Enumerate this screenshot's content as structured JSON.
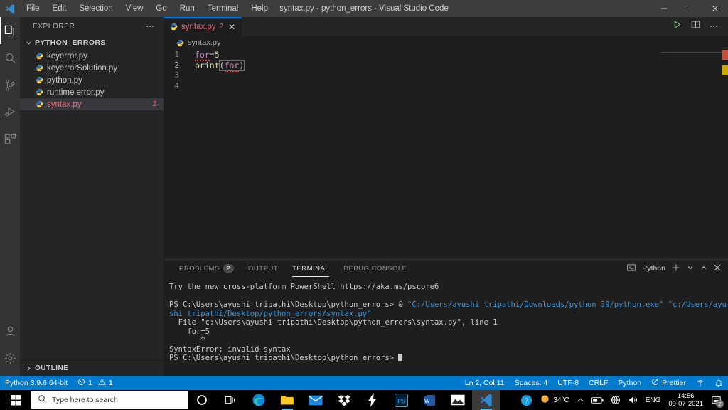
{
  "titlebar": {
    "logo_icon": "vscode-logo-icon",
    "menus": [
      "File",
      "Edit",
      "Selection",
      "View",
      "Go",
      "Run",
      "Terminal",
      "Help"
    ],
    "title": "syntax.py - python_errors - Visual Studio Code",
    "minimize_icon": "minimize-icon",
    "maximize_icon": "maximize-icon",
    "close_icon": "close-icon"
  },
  "activitybar": {
    "items": [
      {
        "name": "explorer",
        "icon": "files-icon",
        "active": true
      },
      {
        "name": "search",
        "icon": "search-icon",
        "active": false
      },
      {
        "name": "source-control",
        "icon": "source-control-icon",
        "active": false
      },
      {
        "name": "run-debug",
        "icon": "run-debug-icon",
        "active": false
      },
      {
        "name": "extensions",
        "icon": "extensions-icon",
        "active": false
      }
    ],
    "bottom": [
      {
        "name": "accounts",
        "icon": "account-icon"
      },
      {
        "name": "settings",
        "icon": "gear-icon"
      }
    ]
  },
  "sidebar": {
    "header": "EXPLORER",
    "more_actions_icon": "ellipsis-icon",
    "folder": "PYTHON_ERRORS",
    "folder_chevron_icon": "chevron-down-icon",
    "files": [
      {
        "name": "keyerror.py",
        "badge": "",
        "selected": false
      },
      {
        "name": "keyerrorSolution.py",
        "badge": "",
        "selected": false
      },
      {
        "name": "python.py",
        "badge": "",
        "selected": false
      },
      {
        "name": "runtime error.py",
        "badge": "",
        "selected": false
      },
      {
        "name": "syntax.py",
        "badge": "2",
        "selected": true
      }
    ],
    "outline": "OUTLINE",
    "outline_chevron_icon": "chevron-right-icon"
  },
  "editor": {
    "tab": {
      "label": "syntax.py",
      "badge": "2",
      "file_icon": "python-file-icon",
      "close_icon": "close-icon"
    },
    "actions": [
      {
        "name": "run-python-file",
        "icon": "play-icon"
      },
      {
        "name": "split-editor",
        "icon": "split-editor-icon"
      },
      {
        "name": "more-actions",
        "icon": "ellipsis-icon"
      }
    ],
    "breadcrumb": "syntax.py",
    "breadcrumb_icon": "python-file-icon",
    "lines": [
      {
        "number": "1",
        "tokens": [
          {
            "t": "for",
            "c": "kw"
          },
          {
            "t": "=",
            "c": "punct"
          },
          {
            "t": "5",
            "c": "num"
          }
        ]
      },
      {
        "number": "2",
        "tokens": [
          {
            "t": "print",
            "c": "fn"
          },
          {
            "t": "(",
            "c": "punct"
          },
          {
            "t": "for",
            "c": "kw"
          },
          {
            "t": ")",
            "c": "punct"
          }
        ]
      },
      {
        "number": "3",
        "tokens": []
      },
      {
        "number": "4",
        "tokens": []
      }
    ]
  },
  "panel": {
    "tabs": [
      {
        "label": "PROBLEMS",
        "badge": "2",
        "active": false
      },
      {
        "label": "OUTPUT",
        "badge": "",
        "active": false
      },
      {
        "label": "TERMINAL",
        "badge": "",
        "active": true
      },
      {
        "label": "DEBUG CONSOLE",
        "badge": "",
        "active": false
      }
    ],
    "shell_icon": "terminal-icon",
    "shell_name": "Python",
    "actions": [
      {
        "name": "new-terminal",
        "icon": "plus-icon"
      },
      {
        "name": "terminal-dropdown",
        "icon": "chevron-down-icon"
      },
      {
        "name": "maximize-panel",
        "icon": "chevron-up-icon"
      },
      {
        "name": "close-panel",
        "icon": "close-icon"
      }
    ],
    "terminal_lines": [
      {
        "text": "Try the new cross-platform PowerShell https://aka.ms/pscore6",
        "class": ""
      },
      {
        "text": "",
        "class": ""
      },
      {
        "text": "PS C:\\Users\\ayushi tripathi\\Desktop\\python_errors> & ",
        "class": "",
        "suffix": "\"C:/Users/ayushi tripathi/Downloads/python 39/python.exe\" \"c:/Users/ayushi tripathi/Desktop/python_errors/syntax.py\"",
        "suffix_class": "t-path"
      },
      {
        "text": "  File \"c:\\Users\\ayushi tripathi\\Desktop\\python_errors\\syntax.py\", line 1",
        "class": ""
      },
      {
        "text": "    for=5",
        "class": ""
      },
      {
        "text": "       ^",
        "class": ""
      },
      {
        "text": "SyntaxError: invalid syntax",
        "class": ""
      },
      {
        "text": "PS C:\\Users\\ayushi tripathi\\Desktop\\python_errors> ",
        "class": "",
        "cursor": true
      }
    ]
  },
  "statusbar": {
    "left": [
      {
        "name": "python-interpreter",
        "label": "Python 3.9.6 64-bit",
        "icon": ""
      },
      {
        "name": "problems-count",
        "label": "1",
        "icon": "error-icon",
        "label2": "1",
        "icon2": "warning-icon"
      }
    ],
    "right": [
      {
        "name": "editor-position",
        "label": "Ln 2, Col 11"
      },
      {
        "name": "indentation",
        "label": "Spaces: 4"
      },
      {
        "name": "encoding",
        "label": "UTF-8"
      },
      {
        "name": "eol",
        "label": "CRLF"
      },
      {
        "name": "language-mode",
        "label": "Python"
      },
      {
        "name": "prettier",
        "label": "Prettier",
        "icon": "prohibited-icon"
      },
      {
        "name": "remote-indicator",
        "label": "",
        "icon": "broadcast-icon"
      },
      {
        "name": "notifications",
        "label": "",
        "icon": "bell-icon"
      }
    ],
    "background": "#007acc"
  },
  "taskbar": {
    "start_icon": "windows-start-icon",
    "search_icon": "search-icon",
    "search_placeholder": "Type here to search",
    "cortana_icon": "cortana-icon",
    "apps": [
      {
        "name": "task-view",
        "icon": "task-view-icon",
        "active": false,
        "running": false
      },
      {
        "name": "microsoft-edge",
        "icon": "edge-icon",
        "active": false,
        "running": false
      },
      {
        "name": "file-explorer",
        "icon": "folder-icon",
        "active": false,
        "running": true
      },
      {
        "name": "mail",
        "icon": "mail-icon",
        "active": false,
        "running": false
      },
      {
        "name": "dropbox",
        "icon": "dropbox-icon",
        "active": false,
        "running": false
      },
      {
        "name": "lightning-app",
        "icon": "lightning-icon",
        "active": false,
        "running": false
      },
      {
        "name": "photoshop",
        "icon": "photoshop-icon",
        "active": false,
        "running": false
      },
      {
        "name": "word",
        "icon": "word-icon",
        "active": false,
        "running": false
      },
      {
        "name": "photos",
        "icon": "photos-icon",
        "active": false,
        "running": false
      },
      {
        "name": "visual-studio-code",
        "icon": "vscode-icon",
        "active": true,
        "running": true
      }
    ],
    "tray": {
      "help_icon": "help-icon",
      "weather_icon": "weather-icon",
      "weather_temp": "34°C",
      "overflow_icon": "chevron-up-icon",
      "battery_icon": "battery-icon",
      "network_icon": "network-icon",
      "volume_icon": "volume-icon",
      "language": "ENG",
      "time": "14:56",
      "date": "09-07-2021",
      "notification_icon": "notification-icon",
      "notification_count": "2"
    }
  }
}
